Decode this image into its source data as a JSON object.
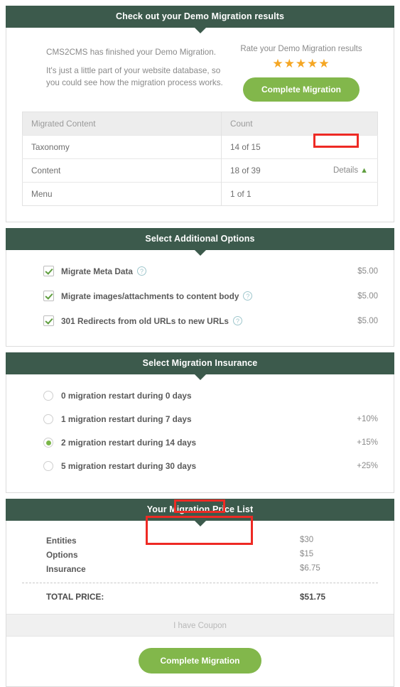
{
  "results": {
    "header": "Check out your Demo Migration results",
    "intro_lines": [
      "CMS2CMS has finished your Demo Migration.",
      "It's just a little part of your website database, so you could see how the migration process works."
    ],
    "rate_label": "Rate your Demo Migration results",
    "stars": "★★★★★",
    "star_count": 5,
    "complete_button": "Complete Migration",
    "table": {
      "columns": [
        "Migrated Content",
        "Count"
      ],
      "rows": [
        {
          "name": "Taxonomy",
          "count": "14 of 15",
          "details": ""
        },
        {
          "name": "Content",
          "count": "18 of 39",
          "details": "Details"
        },
        {
          "name": "Menu",
          "count": "1 of 1",
          "details": ""
        }
      ]
    }
  },
  "options": {
    "header": "Select Additional Options",
    "items": [
      {
        "label": "Migrate Meta Data",
        "price": "$5.00",
        "checked": true,
        "help": "?"
      },
      {
        "label": "Migrate images/attachments to content body",
        "price": "$5.00",
        "checked": true,
        "help": "?"
      },
      {
        "label": "301 Redirects from old URLs to new URLs",
        "price": "$5.00",
        "checked": true,
        "help": "?"
      }
    ]
  },
  "insurance": {
    "header": "Select Migration Insurance",
    "items": [
      {
        "label": "0 migration restart during 0 days",
        "pct": "",
        "selected": false
      },
      {
        "label": "1 migration restart during 7 days",
        "pct": "+10%",
        "selected": false
      },
      {
        "label": "2 migration restart during 14 days",
        "pct": "+15%",
        "selected": true
      },
      {
        "label": "5 migration restart during 30 days",
        "pct": "+25%",
        "selected": false
      }
    ]
  },
  "pricelist": {
    "header": "Your Migration Price List",
    "rows": [
      {
        "name": "Entities",
        "value": "$30"
      },
      {
        "name": "Options",
        "value": "$15"
      },
      {
        "name": "Insurance",
        "value": "$6.75"
      }
    ],
    "total_label": "TOTAL PRICE:",
    "total_value": "$51.75"
  },
  "footer": {
    "coupon_link": "I have Coupon",
    "complete_button": "Complete Migration"
  },
  "colors": {
    "bar_green": "#3c5a4c",
    "button_green": "#82b74b",
    "star_gold": "#f5a623",
    "annotation_red": "#ee2a24",
    "check_green": "#5f9e3f"
  }
}
